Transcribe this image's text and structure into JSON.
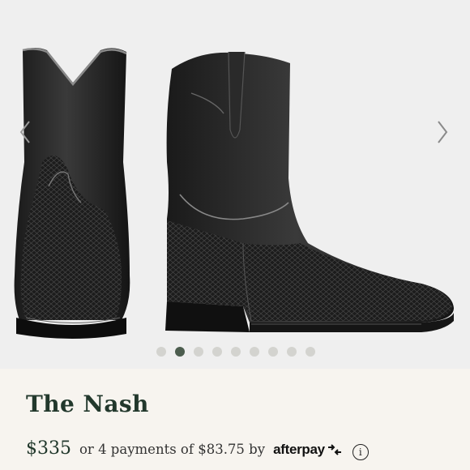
{
  "product": {
    "name": "The Nash",
    "price": "$335",
    "installments_text": "or 4 payments of $83.75 by",
    "payment_provider": "afterpay",
    "info_icon": "i"
  },
  "gallery": {
    "image_count": 9,
    "active_index": 1,
    "prev_icon": "chevron-left-icon",
    "next_icon": "chevron-right-icon",
    "dot_color": "#d3d3cf",
    "active_dot_color": "#4c5d4e"
  },
  "colors": {
    "title": "#22382c",
    "background": "#f7f4ef",
    "image_background": "#efefef"
  }
}
